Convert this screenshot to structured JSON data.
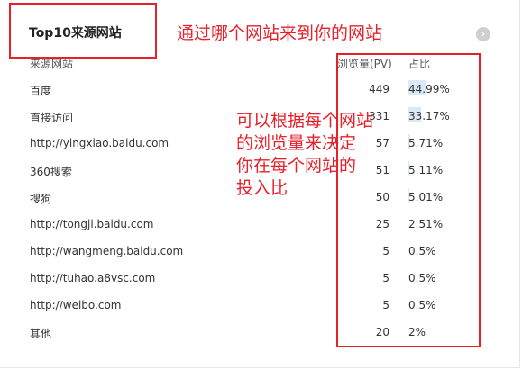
{
  "card": {
    "title": "Top10来源网站",
    "more_icon": "chevron-right-icon"
  },
  "annotations": {
    "top": "通过哪个网站来到你的网站",
    "middle_lines": [
      "可以根据每个网站",
      "的浏览量来决定",
      "你在每个网站的",
      "投入比"
    ],
    "highlight_color": "#e8202a"
  },
  "table": {
    "headers": {
      "site": "来源网站",
      "pv": "浏览量(PV)",
      "pct": "占比"
    },
    "bar_color": "#dce8f7",
    "rows": [
      {
        "site": "百度",
        "pv": "449",
        "pct": "44.99%",
        "share": 44.99
      },
      {
        "site": "直接访问",
        "pv": "331",
        "pct": "33.17%",
        "share": 33.17
      },
      {
        "site": "http://yingxiao.baidu.com",
        "pv": "57",
        "pct": "5.71%",
        "share": 5.71
      },
      {
        "site": "360搜索",
        "pv": "51",
        "pct": "5.11%",
        "share": 5.11
      },
      {
        "site": "搜狗",
        "pv": "50",
        "pct": "5.01%",
        "share": 5.01
      },
      {
        "site": "http://tongji.baidu.com",
        "pv": "25",
        "pct": "2.51%",
        "share": 2.51
      },
      {
        "site": "http://wangmeng.baidu.com",
        "pv": "5",
        "pct": "0.5%",
        "share": 0.5
      },
      {
        "site": "http://tuhao.a8vsc.com",
        "pv": "5",
        "pct": "0.5%",
        "share": 0.5
      },
      {
        "site": "http://weibo.com",
        "pv": "5",
        "pct": "0.5%",
        "share": 0.5
      },
      {
        "site": "其他",
        "pv": "20",
        "pct": "2%",
        "share": 2
      }
    ]
  }
}
